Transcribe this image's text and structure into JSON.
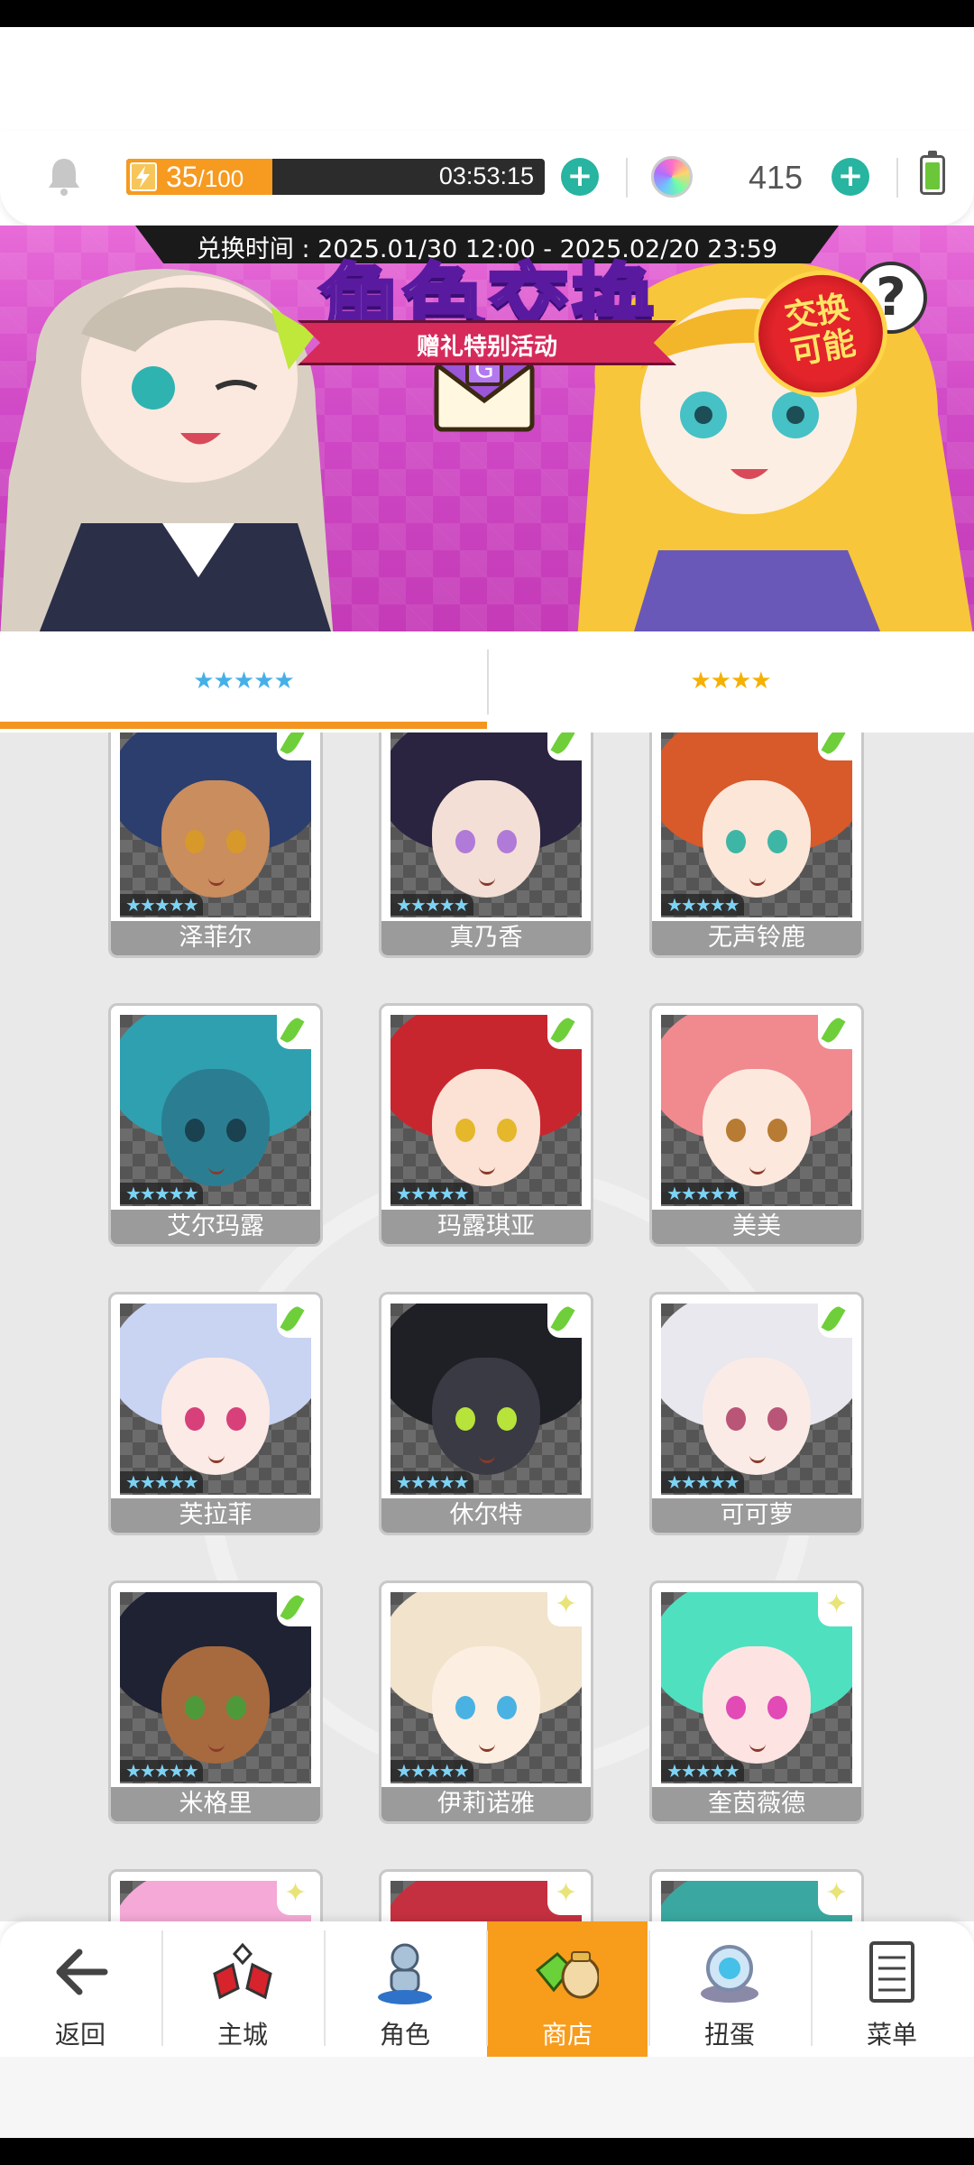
{
  "topbar": {
    "energy_current": "35",
    "energy_max": "/100",
    "energy_fraction": 0.35,
    "energy_timer": "03:53:15",
    "gem_count": "415",
    "plus": "+"
  },
  "banner": {
    "period": "兑换时间 : 2025.01/30 12:00 - 2025.02/20 23:59",
    "title": "角色交换",
    "subtitle": "赠礼特别活动",
    "badge_line1": "交换",
    "badge_line2": "可能",
    "help": "?"
  },
  "tabs": [
    {
      "stars": "★★★★★",
      "active": true
    },
    {
      "stars": "★★★★",
      "active": false
    }
  ],
  "card_stars": "★★★★★",
  "characters": [
    {
      "name": "泽菲尔",
      "hair": "#2c3e6e",
      "face": "#c98d5e",
      "eye": "#d79a2a",
      "badge": "leaf"
    },
    {
      "name": "真乃香",
      "hair": "#2a2440",
      "face": "#f3dfd6",
      "eye": "#b07ad8",
      "badge": "leaf"
    },
    {
      "name": "无声铃鹿",
      "hair": "#d8592a",
      "face": "#fbe6d8",
      "eye": "#3eb6a6",
      "badge": "leaf"
    },
    {
      "name": "艾尔玛露",
      "hair": "#2fa0b0",
      "face": "#2b7e92",
      "eye": "#1a4150",
      "badge": "leaf"
    },
    {
      "name": "玛露琪亚",
      "hair": "#c8262e",
      "face": "#fbe2d4",
      "eye": "#e5b72a",
      "badge": "leaf"
    },
    {
      "name": "美美",
      "hair": "#f08a8e",
      "face": "#fde8de",
      "eye": "#b77b33",
      "badge": "leaf"
    },
    {
      "name": "芙拉菲",
      "hair": "#c9d3f2",
      "face": "#fbeae6",
      "eye": "#d8407a",
      "badge": "leaf"
    },
    {
      "name": "休尔特",
      "hair": "#1f1f26",
      "face": "#3a3a44",
      "eye": "#b7e33a",
      "badge": "leaf"
    },
    {
      "name": "可可萝",
      "hair": "#e8e8ee",
      "face": "#fbebe6",
      "eye": "#b95576",
      "badge": "leaf"
    },
    {
      "name": "米格里",
      "hair": "#1e2233",
      "face": "#a66a3e",
      "eye": "#4e9a3a",
      "badge": "leaf"
    },
    {
      "name": "伊莉诺雅",
      "hair": "#f1e3cc",
      "face": "#fdeee2",
      "eye": "#4ab2e2",
      "badge": "sparkle"
    },
    {
      "name": "奎茵薇德",
      "hair": "#4fe0c0",
      "face": "#fde4e2",
      "eye": "#e24ab6",
      "badge": "sparkle"
    }
  ],
  "partial_row": [
    {
      "hair": "#f5a9d6",
      "badge": "sparkle"
    },
    {
      "hair": "#c53040",
      "badge": "sparkle"
    },
    {
      "hair": "#3aa8a0",
      "badge": "sparkle"
    }
  ],
  "nav": [
    {
      "label": "返回",
      "icon": "back-arrow-icon"
    },
    {
      "label": "主城",
      "icon": "castle-icon"
    },
    {
      "label": "角色",
      "icon": "character-icon"
    },
    {
      "label": "商店",
      "icon": "shop-icon",
      "active": true
    },
    {
      "label": "扭蛋",
      "icon": "gacha-icon"
    },
    {
      "label": "菜单",
      "icon": "menu-icon"
    }
  ],
  "colors": {
    "accent": "#f89c1c",
    "plus": "#27b4a1",
    "energy": "#f79a20"
  }
}
